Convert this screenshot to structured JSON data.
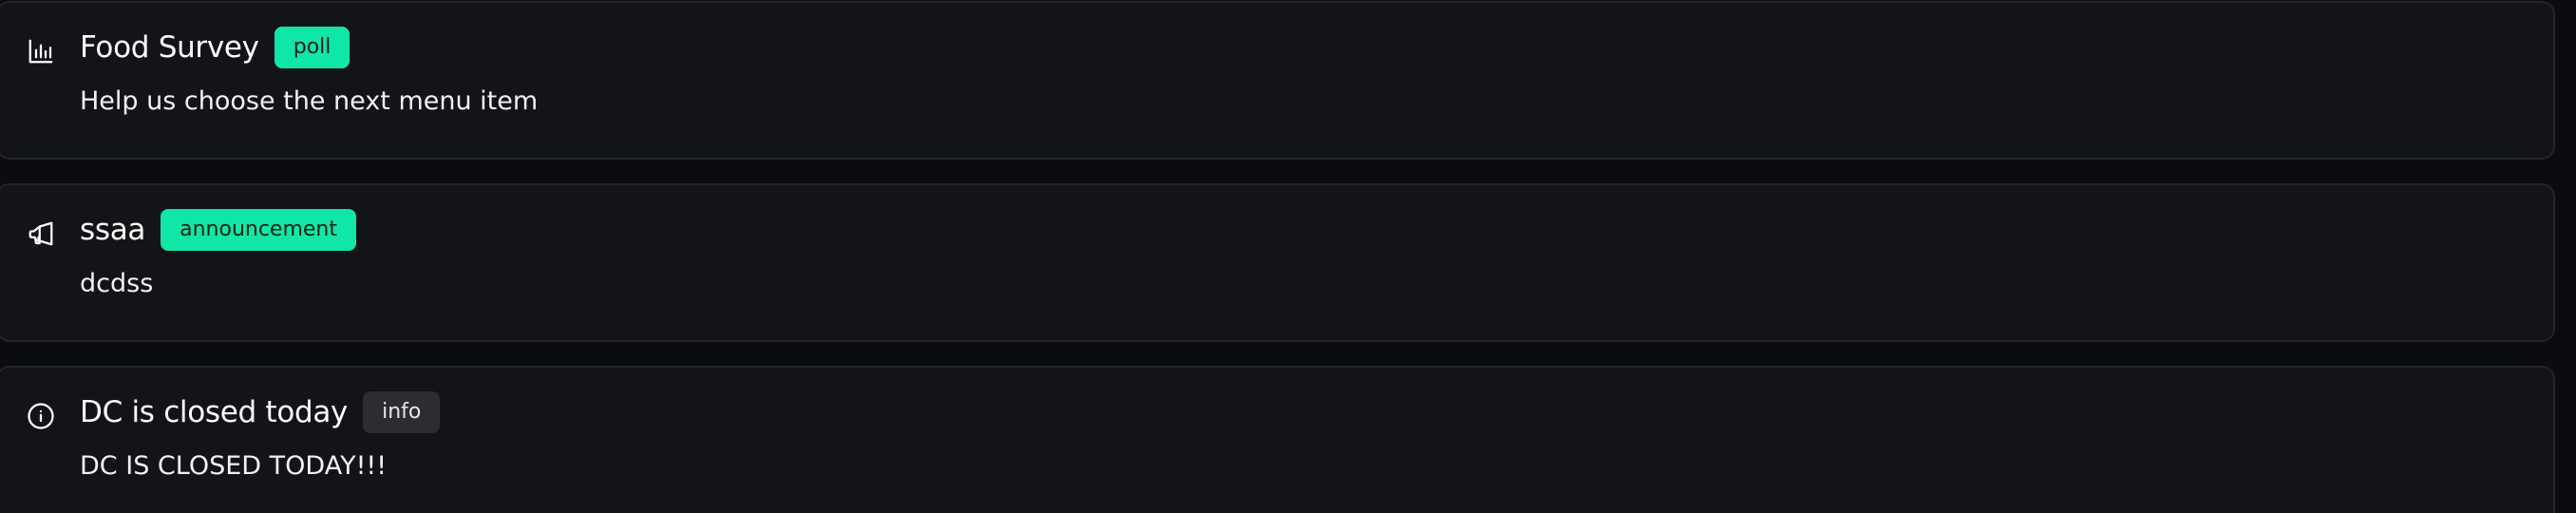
{
  "colors": {
    "background": "#0b0c0f",
    "card": "#131418",
    "card_border": "#23252b",
    "accent_badge": "#10e7a7",
    "neutral_badge": "#2c2d33"
  },
  "posts": [
    {
      "icon": "bar-chart-icon",
      "title": "Food Survey",
      "badge": "poll",
      "body": "Help us choose the next menu item"
    },
    {
      "icon": "megaphone-icon",
      "title": "ssaa",
      "badge": "announcement",
      "body": "dcdss"
    },
    {
      "icon": "info-icon",
      "title": "DC is closed today",
      "badge": "info",
      "body": "DC IS CLOSED TODAY!!!"
    }
  ]
}
